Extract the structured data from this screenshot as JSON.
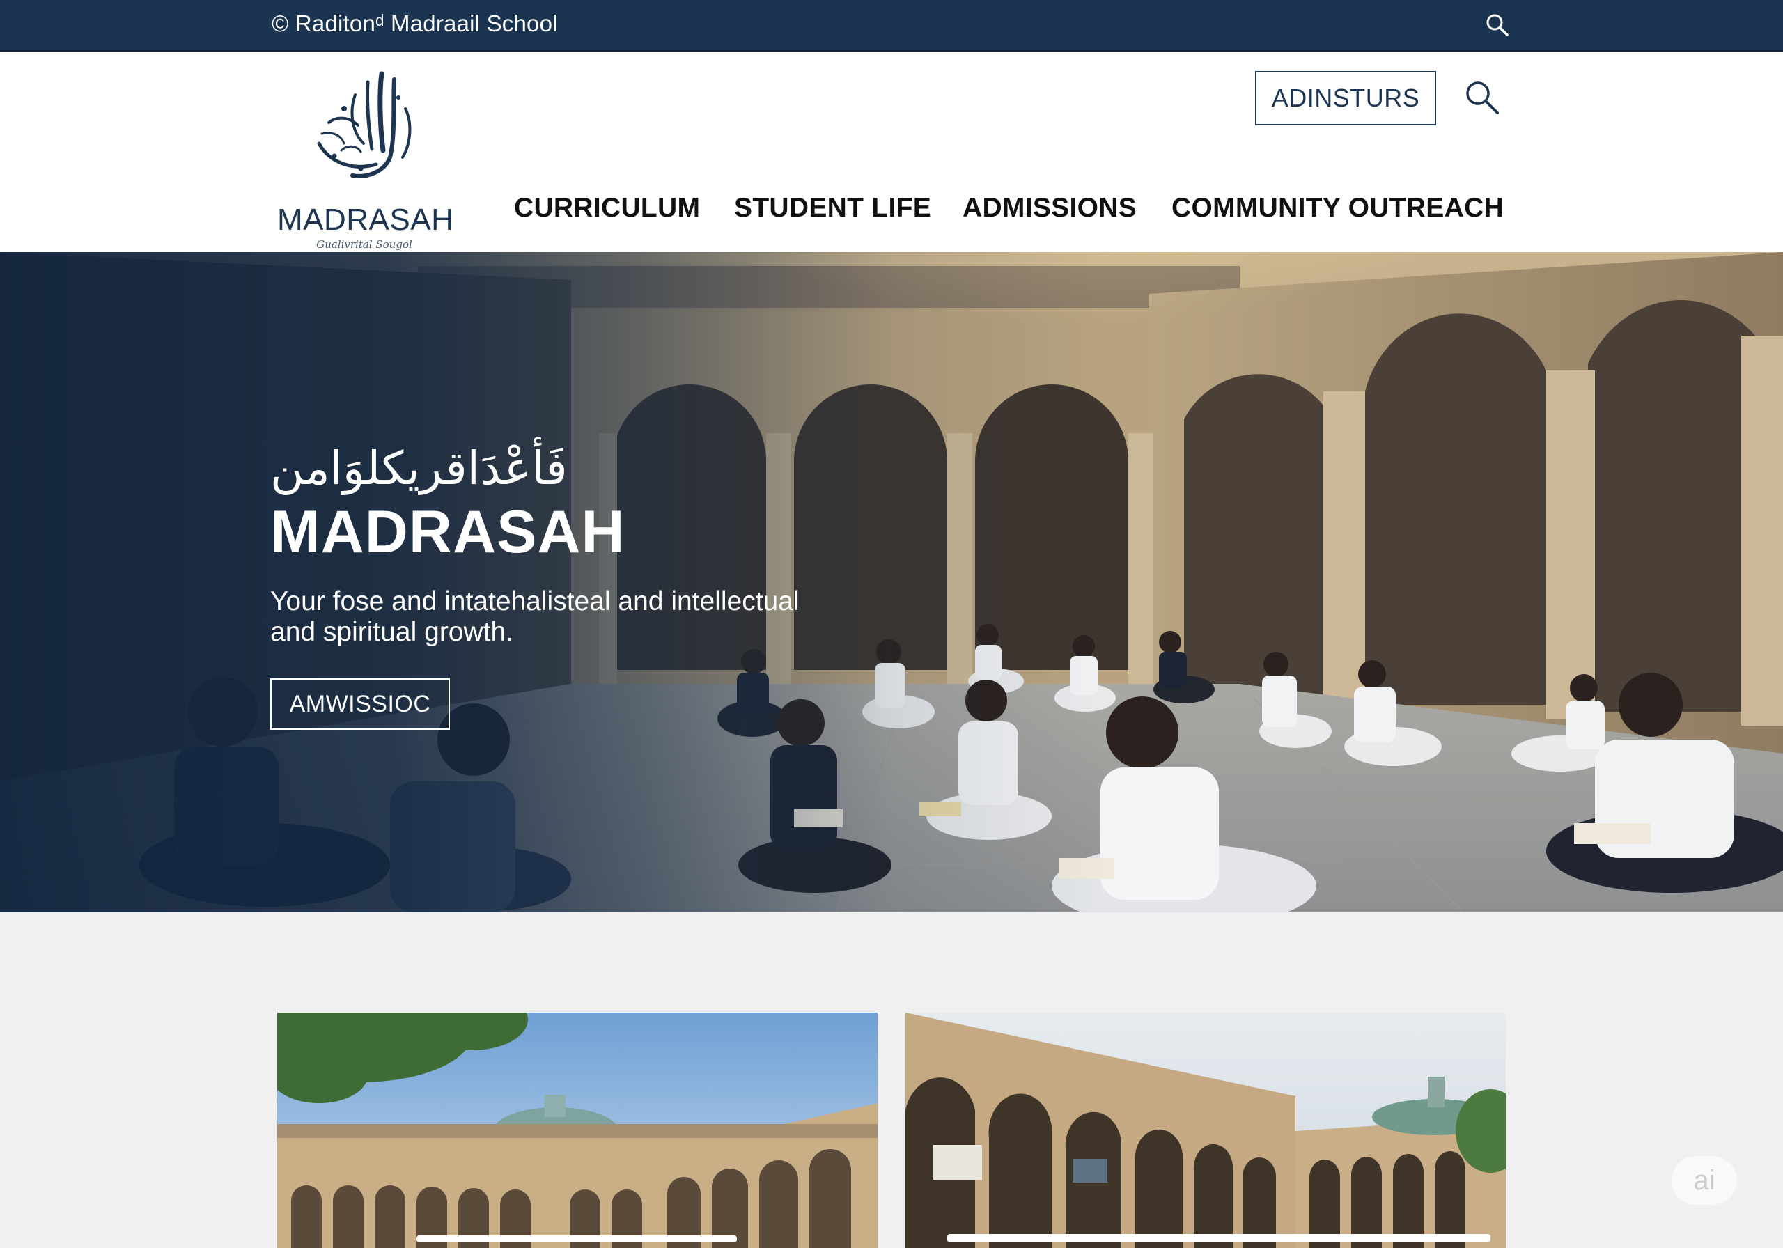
{
  "topbar": {
    "title": "© Raditonᵈ Madraail School",
    "search_icon": "search-icon"
  },
  "header": {
    "logo": {
      "name": "MADRASAH",
      "tagline": "Gualivrital Sougol",
      "mark_icon": "arabic-calligraphy-logo-icon"
    },
    "button_label": "ADINSTURS",
    "search_icon": "search-icon"
  },
  "nav": {
    "items": [
      {
        "label": "CURRICULUM"
      },
      {
        "label": "STUDENT LIFE"
      },
      {
        "label": "ADMISSIONS"
      },
      {
        "label": "COMMUNITY OUTREACH"
      }
    ]
  },
  "hero": {
    "arabic_heading": "فَأعْدَاقريكلوَامن",
    "title": "MADRASAH",
    "subtitle": "Your fose  and intatehalisteal and intellectual and spiritual growth.",
    "button_label": "AMWISSIOC",
    "image": "courtyard-students-reading-photo"
  },
  "cards": [
    {
      "image": "madrasah-courtyard-dome-photo"
    },
    {
      "image": "madrasah-arcade-courtyard-photo"
    }
  ],
  "badge": {
    "label": "ai"
  },
  "colors": {
    "navy": "#1b3452",
    "brand_text": "#1d3550",
    "page_bg": "#f0f0f0",
    "white": "#ffffff"
  }
}
